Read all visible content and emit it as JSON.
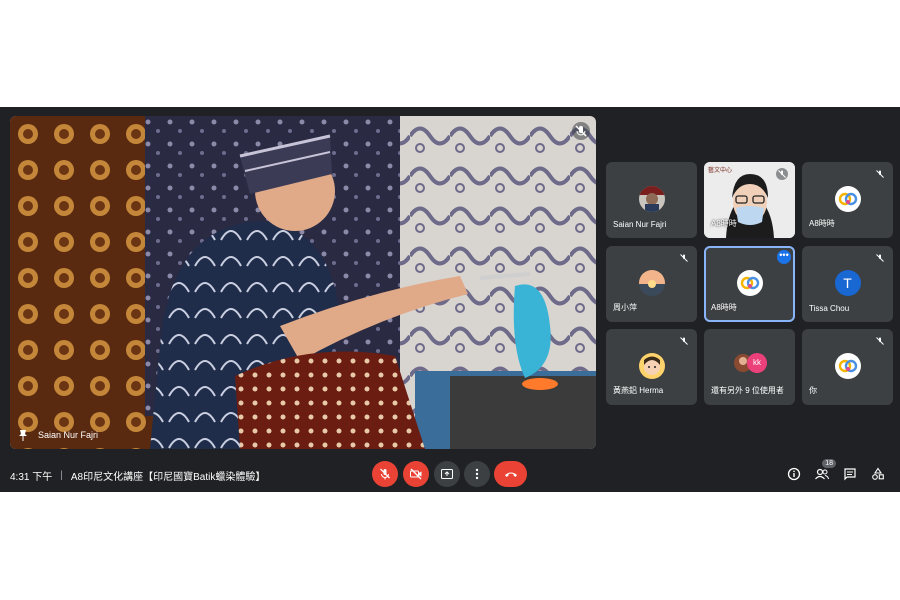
{
  "main": {
    "speaker_name": "Saian Nur Fajri"
  },
  "tiles": [
    {
      "name": "Saian Nur Fajri",
      "avatar": "photo",
      "muted": false
    },
    {
      "name": "A8時時",
      "avatar": "camera-person",
      "muted": true,
      "overlay_text": "藝文中心"
    },
    {
      "name": "A8時時",
      "avatar": "logo",
      "muted": true
    },
    {
      "name": "周小萍",
      "avatar": "photo-sunset",
      "muted": true
    },
    {
      "name": "A8時時",
      "avatar": "logo",
      "muted": false,
      "active": true
    },
    {
      "name": "Tissa Chou",
      "avatar": "letter",
      "letter": "T",
      "muted": true
    },
    {
      "name": "黃燕鋁 Herma",
      "avatar": "photo-girl",
      "muted": true
    },
    {
      "name": "還有另外 9 位使用者",
      "avatar": "group",
      "group_initials": "kk"
    },
    {
      "name": "你",
      "avatar": "logo",
      "muted": true
    }
  ],
  "bottom_bar": {
    "time": "4:31 下午",
    "meeting_title": "A8印尼文化講座【印尼國寶Batik蠟染體驗】",
    "participant_count": "18"
  },
  "colors": {
    "background": "#202124",
    "tile": "#3c4043",
    "danger": "#ea4335",
    "accent": "#8ab4f8"
  }
}
